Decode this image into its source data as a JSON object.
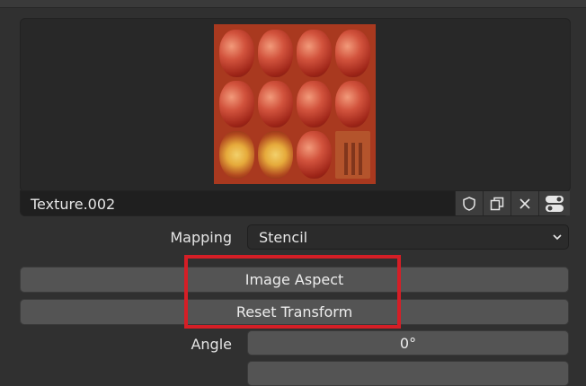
{
  "texture": {
    "name": "Texture.002"
  },
  "mapping": {
    "label": "Mapping",
    "value": "Stencil"
  },
  "buttons": {
    "image_aspect": "Image Aspect",
    "reset_transform": "Reset Transform"
  },
  "angle": {
    "label": "Angle",
    "value": "0°"
  },
  "icons": [
    "shield-icon",
    "duplicate-icon",
    "close-icon",
    "toggle-icon",
    "chevron-down-icon"
  ],
  "colors": {
    "highlight": "#d51e26"
  }
}
